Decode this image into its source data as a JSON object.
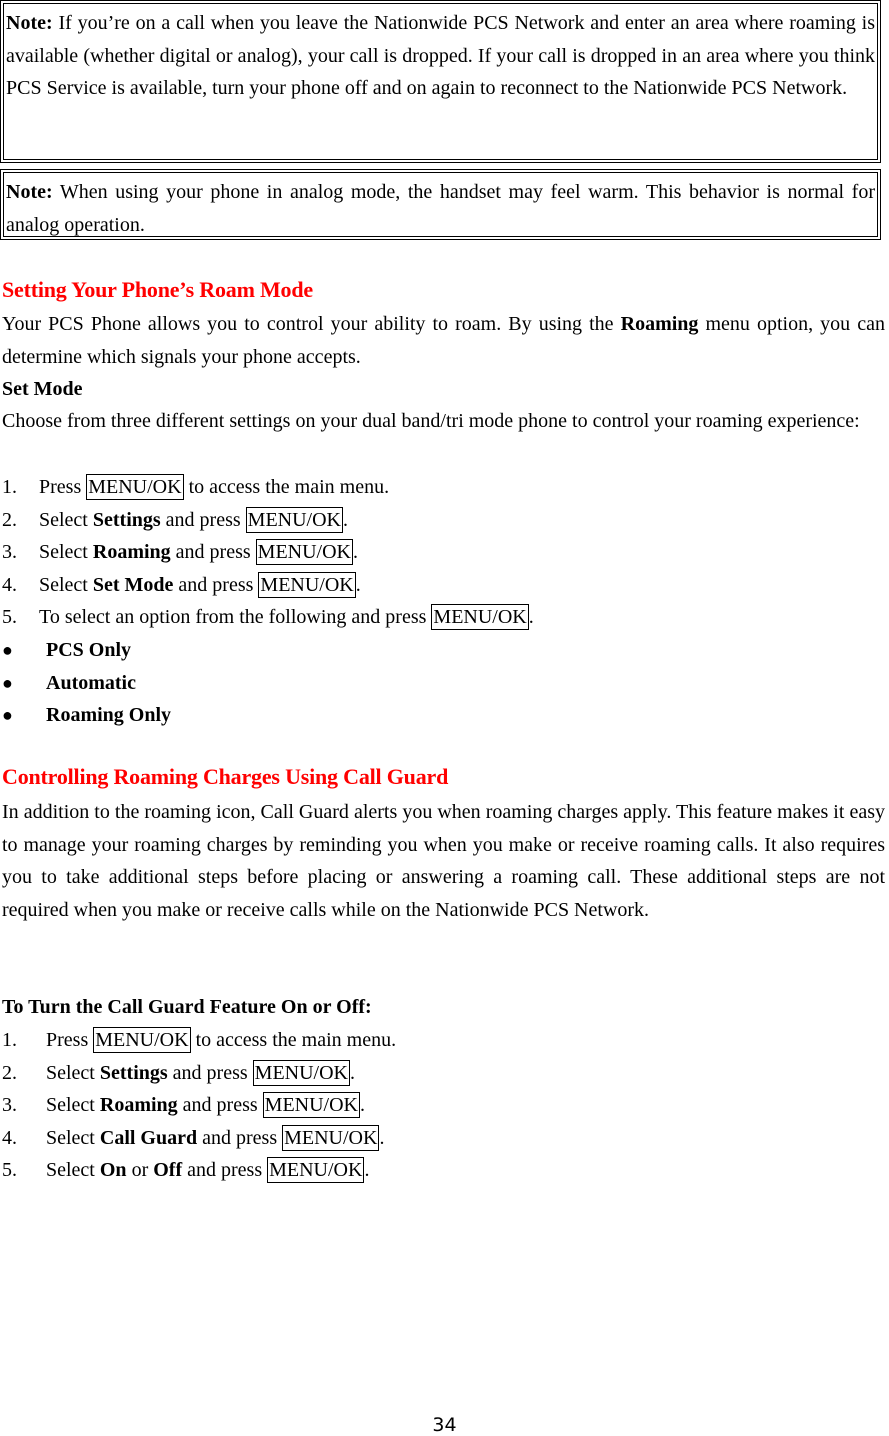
{
  "notes": [
    {
      "label": "Note:",
      "text": " If you’re on a call when you leave the Nationwide PCS Network and enter an area where roaming is available (whether digital or analog), your call is dropped. If your call is dropped in an area where you think PCS Service is available, turn your phone off and on again to reconnect to the Nationwide PCS Network."
    },
    {
      "label": "Note:",
      "text": " When using your phone in analog mode, the handset may feel warm. This behavior is normal for analog operation."
    }
  ],
  "section1": {
    "heading": "Setting Your Phone’s Roam Mode",
    "intro_pre": "Your PCS Phone allows you to control your ability to roam. By using the ",
    "intro_bold": "Roaming",
    "intro_post": " menu option, you can determine which signals your phone accepts.",
    "subheading": "Set Mode",
    "choose_text": "Choose from three different settings on your dual band/tri mode phone to control your roaming experience:",
    "steps": [
      {
        "num": "1.",
        "pre": "Press ",
        "bold": "",
        "mid": "",
        "key": "MENU/OK",
        "post": " to access the main menu."
      },
      {
        "num": "2.",
        "pre": "Select ",
        "bold": "Settings",
        "mid": " and press ",
        "key": "MENU/OK",
        "post": "."
      },
      {
        "num": "3.",
        "pre": "Select ",
        "bold": "Roaming",
        "mid": " and press ",
        "key": "MENU/OK",
        "post": "."
      },
      {
        "num": "4.",
        "pre": "Select ",
        "bold": "Set Mode",
        "mid": " and press ",
        "key": "MENU/OK",
        "post": "."
      },
      {
        "num": "5.",
        "pre": "To select an option from the following and press ",
        "bold": "",
        "mid": "",
        "key": "MENU/OK",
        "post": "."
      }
    ],
    "options": [
      "PCS Only",
      "Automatic",
      "Roaming Only"
    ],
    "bullet_glyph": "●"
  },
  "section2": {
    "heading": "Controlling Roaming Charges Using Call Guard",
    "paragraph": "In addition to the roaming icon, Call Guard alerts you when roaming charges apply. This feature makes it easy to manage your roaming charges by reminding you when you make or receive roaming calls. It also requires you to take additional steps before placing or answering a roaming call. These additional steps are not required when you make or receive calls while on the Nationwide PCS Network.",
    "subheading": "To Turn the Call Guard Feature On or Off:",
    "steps": [
      {
        "num": "1.",
        "pre": "Press ",
        "bold": "",
        "mid": "",
        "bold2": "",
        "mid2": "",
        "key": "MENU/OK",
        "post": " to access the main menu."
      },
      {
        "num": "2.",
        "pre": "Select ",
        "bold": "Settings",
        "mid": " and press ",
        "bold2": "",
        "mid2": "",
        "key": "MENU/OK",
        "post": "."
      },
      {
        "num": "3.",
        "pre": "Select ",
        "bold": "Roaming",
        "mid": " and press ",
        "bold2": "",
        "mid2": "",
        "key": "MENU/OK",
        "post": "."
      },
      {
        "num": "4.",
        "pre": "Select ",
        "bold": "Call Guard",
        "mid": " and press ",
        "bold2": "",
        "mid2": "",
        "key": "MENU/OK",
        "post": "."
      },
      {
        "num": "5.",
        "pre": "Select ",
        "bold": "On",
        "mid": " or ",
        "bold2": "Off",
        "mid2": " and press ",
        "key": "MENU/OK",
        "post": "."
      }
    ]
  },
  "page_number": "34"
}
